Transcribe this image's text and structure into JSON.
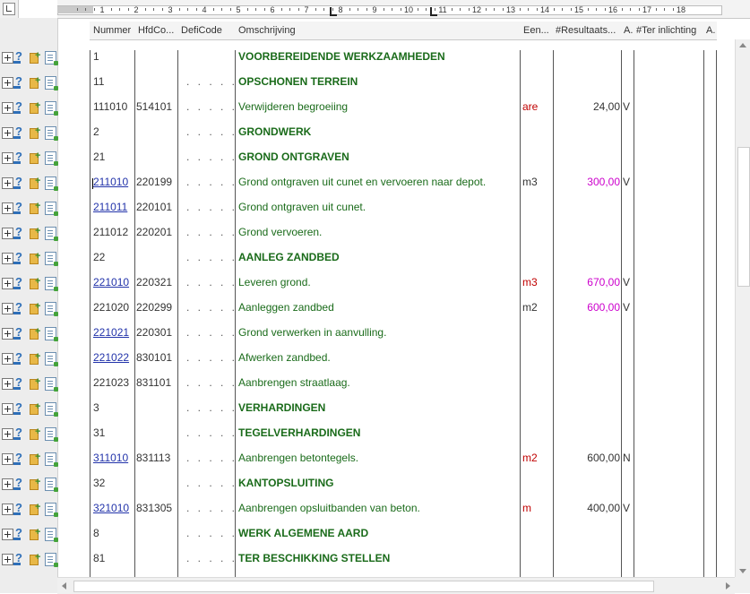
{
  "ruler": {
    "numbers": [
      "1",
      "2",
      "3",
      "4",
      "5",
      "6",
      "7",
      "8",
      "9",
      "10",
      "11",
      "12",
      "13",
      "14",
      "15",
      "16",
      "17",
      "18"
    ]
  },
  "header": {
    "nummer": "Nummer",
    "hfdcode": "HfdCo...",
    "deficode": "DefiCode",
    "omschrijving": "Omschrijving",
    "eenheid": "Een...",
    "resultaat": "#Resultaats...",
    "a1": "A.",
    "terinlichting": "#Ter inlichting",
    "a2": "A."
  },
  "rows": [
    {
      "nummer": "1",
      "hfd": "",
      "defi": "",
      "oms": "VOORBEREIDENDE WERKZAAMHEDEN",
      "een": "",
      "res": "",
      "a": ""
    },
    {
      "nummer": "11",
      "hfd": "",
      "defi": ". . . . .",
      "oms": "OPSCHONEN TERREIN",
      "een": "",
      "res": "",
      "a": ""
    },
    {
      "nummer": "111010",
      "hfd": "514101",
      "defi": ". . . . .",
      "oms": "Verwijderen begroeiing",
      "een": "are",
      "res": "24,00",
      "a": "V"
    },
    {
      "nummer": "2",
      "hfd": "",
      "defi": ". . . . .",
      "oms": "GRONDWERK",
      "een": "",
      "res": "",
      "a": ""
    },
    {
      "nummer": "21",
      "hfd": "",
      "defi": ". . . . .",
      "oms": "GROND ONTGRAVEN",
      "een": "",
      "res": "",
      "a": ""
    },
    {
      "nummer": "211010",
      "hfd": "220199",
      "defi": ". . . . .",
      "oms": "Grond ontgraven uit cunet en vervoeren naar depot.",
      "een": "m3",
      "res": "300,00",
      "a": "V"
    },
    {
      "nummer": "211011",
      "hfd": "220101",
      "defi": ". . . . .",
      "oms": "Grond ontgraven uit cunet.",
      "een": "",
      "res": "",
      "a": ""
    },
    {
      "nummer": "211012",
      "hfd": "220201",
      "defi": ". . . . .",
      "oms": "Grond vervoeren.",
      "een": "",
      "res": "",
      "a": ""
    },
    {
      "nummer": "22",
      "hfd": "",
      "defi": ". . . . .",
      "oms": "AANLEG ZANDBED",
      "een": "",
      "res": "",
      "a": ""
    },
    {
      "nummer": "221010",
      "hfd": "220321",
      "defi": ". . . . .",
      "oms": "Leveren grond.",
      "een": "m3",
      "res": "670,00",
      "a": "V"
    },
    {
      "nummer": "221020",
      "hfd": "220299",
      "defi": ". . . . .",
      "oms": "Aanleggen zandbed",
      "een": "m2",
      "res": "600,00",
      "a": "V"
    },
    {
      "nummer": "221021",
      "hfd": "220301",
      "defi": ". . . . .",
      "oms": "Grond verwerken in aanvulling.",
      "een": "",
      "res": "",
      "a": ""
    },
    {
      "nummer": "221022",
      "hfd": "830101",
      "defi": ". . . . .",
      "oms": "Afwerken zandbed.",
      "een": "",
      "res": "",
      "a": ""
    },
    {
      "nummer": "221023",
      "hfd": "831101",
      "defi": ". . . . .",
      "oms": "Aanbrengen straatlaag.",
      "een": "",
      "res": "",
      "a": ""
    },
    {
      "nummer": "3",
      "hfd": "",
      "defi": ". . . . .",
      "oms": "VERHARDINGEN",
      "een": "",
      "res": "",
      "a": ""
    },
    {
      "nummer": "31",
      "hfd": "",
      "defi": ". . . . .",
      "oms": "TEGELVERHARDINGEN",
      "een": "",
      "res": "",
      "a": ""
    },
    {
      "nummer": "311010",
      "hfd": "831113",
      "defi": ". . . . .",
      "oms": "Aanbrengen betontegels.",
      "een": "m2",
      "res": "600,00",
      "a": "N"
    },
    {
      "nummer": "32",
      "hfd": "",
      "defi": ". . . . .",
      "oms": "KANTOPSLUITING",
      "een": "",
      "res": "",
      "a": ""
    },
    {
      "nummer": "321010",
      "hfd": "831305",
      "defi": ". . . . .",
      "oms": "Aanbrengen opsluitbanden van beton.",
      "een": "m",
      "res": "400,00",
      "a": "V"
    },
    {
      "nummer": "8",
      "hfd": "",
      "defi": ". . . . .",
      "oms": "WERK ALGEMENE AARD",
      "een": "",
      "res": "",
      "a": ""
    },
    {
      "nummer": "81",
      "hfd": "",
      "defi": ". . . . .",
      "oms": "TER BESCHIKKING STELLEN",
      "een": "",
      "res": "",
      "a": ""
    }
  ],
  "colors": {
    "green_text": "#1a6b1a",
    "unit_red": "#c00000",
    "value_magenta": "#cc00cc",
    "link_blue": "#2233aa"
  }
}
